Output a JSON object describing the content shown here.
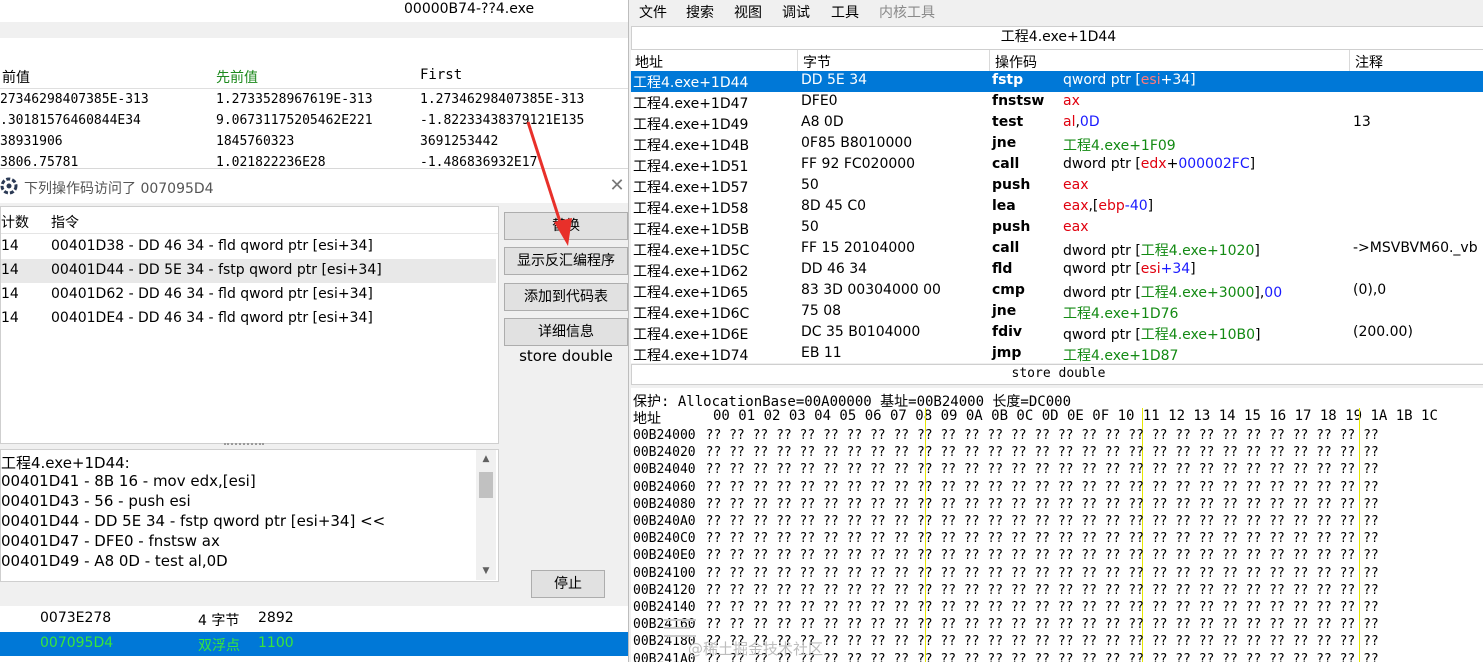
{
  "ce_window": {
    "title": "00000B74-??4.exe",
    "scan_headers": [
      "前值",
      "先前值",
      "First"
    ],
    "scan_rows": [
      [
        "27346298407385E-313",
        "1.2733528967619E-313",
        "1.27346298407385E-313"
      ],
      [
        ".30181576460844E34",
        "9.06731175205462E221",
        "-1.82233438379121E135"
      ],
      [
        "38931906",
        "1845760323",
        "3691253442"
      ],
      [
        "3806.75781",
        "1.021822236E28",
        "-1.486836932E17"
      ]
    ]
  },
  "dialog": {
    "title": "下列操作码访问了 007095D4",
    "close_glyph": "✕",
    "headers": {
      "count": "计数",
      "instruction": "指令"
    },
    "rows": [
      {
        "count": "14",
        "instruction": "00401D38 - DD 46 34  - fld qword ptr [esi+34]",
        "selected": false
      },
      {
        "count": "14",
        "instruction": "00401D44 - DD 5E 34  - fstp qword ptr [esi+34]",
        "selected": true
      },
      {
        "count": "14",
        "instruction": "00401D62 - DD 46 34  - fld qword ptr [esi+34]",
        "selected": false
      },
      {
        "count": "14",
        "instruction": "00401DE4 - DD 46 34  - fld qword ptr [esi+34]",
        "selected": false
      }
    ],
    "buttons": {
      "replace": "替换",
      "show_disasm": "显示反汇编程序",
      "add_to_codelist": "添加到代码表",
      "details": "详细信息",
      "stop": "停止"
    },
    "desc": "store double",
    "disasm_lines": [
      "工程4.exe+1D44:",
      "00401D41 - 8B 16  - mov edx,[esi]",
      "00401D43 - 56 - push esi",
      "00401D44 - DD 5E 34  - fstp qword ptr [esi+34] <<",
      "00401D47 - DFE0 - fnstsw ax",
      "00401D49 - A8 0D - test al,0D"
    ],
    "scroll_up": "▲",
    "scroll_down": "▼"
  },
  "addr_list": [
    {
      "address": "0073E278",
      "type": "4 字节",
      "value": "2892",
      "selected": false
    },
    {
      "address": "007095D4",
      "type": "双浮点",
      "value": "1100",
      "selected": true
    }
  ],
  "memview": {
    "menu": [
      "文件",
      "搜索",
      "视图",
      "调试",
      "工具",
      "内核工具"
    ],
    "title": "工程4.exe+1D44",
    "headers": [
      "地址",
      "字节",
      "操作码",
      "注释"
    ],
    "rows": [
      {
        "addr": "工程4.exe+1D44",
        "bytes": "DD 5E 34",
        "op": "fstp",
        "sel": true,
        "args": [
          [
            "qword ptr [",
            ""
          ],
          [
            "esi",
            "r"
          ],
          [
            "+34]",
            "b"
          ]
        ],
        "comment": ""
      },
      {
        "addr": "工程4.exe+1D47",
        "bytes": "DFE0",
        "op": "fnstsw",
        "sel": false,
        "args": [
          [
            "ax",
            "r"
          ]
        ],
        "comment": ""
      },
      {
        "addr": "工程4.exe+1D49",
        "bytes": "A8 0D",
        "op": "test",
        "sel": false,
        "args": [
          [
            "al",
            "r"
          ],
          [
            ",",
            ""
          ],
          [
            "0D",
            "b"
          ]
        ],
        "comment": "13"
      },
      {
        "addr": "工程4.exe+1D4B",
        "bytes": "0F85 B8010000",
        "op": "jne",
        "sel": false,
        "args": [
          [
            "工程4.exe+1F09",
            "g"
          ]
        ],
        "comment": ""
      },
      {
        "addr": "工程4.exe+1D51",
        "bytes": "FF 92 FC020000",
        "op": "call",
        "sel": false,
        "args": [
          [
            "dword ptr [",
            ""
          ],
          [
            "edx",
            "r"
          ],
          [
            "+",
            ""
          ],
          [
            "000002FC",
            "b"
          ],
          [
            "]",
            ""
          ]
        ],
        "comment": ""
      },
      {
        "addr": "工程4.exe+1D57",
        "bytes": "50",
        "op": "push",
        "sel": false,
        "args": [
          [
            "eax",
            "r"
          ]
        ],
        "comment": ""
      },
      {
        "addr": "工程4.exe+1D58",
        "bytes": "8D 45 C0",
        "op": "lea",
        "sel": false,
        "args": [
          [
            "eax",
            "r"
          ],
          [
            ",[",
            ""
          ],
          [
            "ebp",
            "r"
          ],
          [
            "-40",
            "b"
          ],
          [
            "]",
            ""
          ]
        ],
        "comment": ""
      },
      {
        "addr": "工程4.exe+1D5B",
        "bytes": "50",
        "op": "push",
        "sel": false,
        "args": [
          [
            "eax",
            "r"
          ]
        ],
        "comment": ""
      },
      {
        "addr": "工程4.exe+1D5C",
        "bytes": "FF 15 20104000",
        "op": "call",
        "sel": false,
        "args": [
          [
            "dword ptr [",
            ""
          ],
          [
            "工程4.exe+1020",
            "g"
          ],
          [
            "]",
            ""
          ]
        ],
        "comment": "->MSVBVM60._vb"
      },
      {
        "addr": "工程4.exe+1D62",
        "bytes": "DD 46 34",
        "op": "fld",
        "sel": false,
        "args": [
          [
            "qword ptr [",
            ""
          ],
          [
            "esi",
            "r"
          ],
          [
            "+34",
            "b"
          ],
          [
            "]",
            ""
          ]
        ],
        "comment": ""
      },
      {
        "addr": "工程4.exe+1D65",
        "bytes": "83 3D 00304000 00",
        "op": "cmp",
        "sel": false,
        "args": [
          [
            "dword ptr [",
            ""
          ],
          [
            "工程4.exe+3000",
            "g"
          ],
          [
            "],",
            ""
          ],
          [
            "00",
            "b"
          ]
        ],
        "comment": "(0),0"
      },
      {
        "addr": "工程4.exe+1D6C",
        "bytes": "75 08",
        "op": "jne",
        "sel": false,
        "args": [
          [
            "工程4.exe+1D76",
            "g"
          ]
        ],
        "comment": ""
      },
      {
        "addr": "工程4.exe+1D6E",
        "bytes": "DC 35 B0104000",
        "op": "fdiv",
        "sel": false,
        "args": [
          [
            "qword ptr [",
            ""
          ],
          [
            "工程4.exe+10B0",
            "g"
          ],
          [
            "]",
            ""
          ]
        ],
        "comment": "(200.00)"
      },
      {
        "addr": "工程4.exe+1D74",
        "bytes": "EB 11",
        "op": "jmp",
        "sel": false,
        "args": [
          [
            "工程4.exe+1D87",
            "g"
          ]
        ],
        "comment": ""
      }
    ],
    "status": "store double",
    "hex_info": "保护: AllocationBase=00A00000  基址=00B24000  长度=DC000",
    "hex_header_label": "地址",
    "hex_columns": "00 01 02 03 04 05 06 07 08 09 0A 0B 0C 0D 0E 0F 10 11 12 13 14 15 16 17 18 19 1A 1B 1C",
    "hex_rows": [
      "00B24000",
      "00B24020",
      "00B24040",
      "00B24060",
      "00B24080",
      "00B240A0",
      "00B240C0",
      "00B240E0",
      "00B24100",
      "00B24120",
      "00B24140",
      "00B24160",
      "00B24180",
      "00B241A0"
    ],
    "hex_cell": "??"
  },
  "watermark": "@稀土掘金技术社区",
  "colors": {
    "selection": "#0078d7",
    "register": "#e0000e",
    "immediate": "#1a1aff",
    "symbol": "#138a13",
    "arrow": "#e8302a"
  }
}
